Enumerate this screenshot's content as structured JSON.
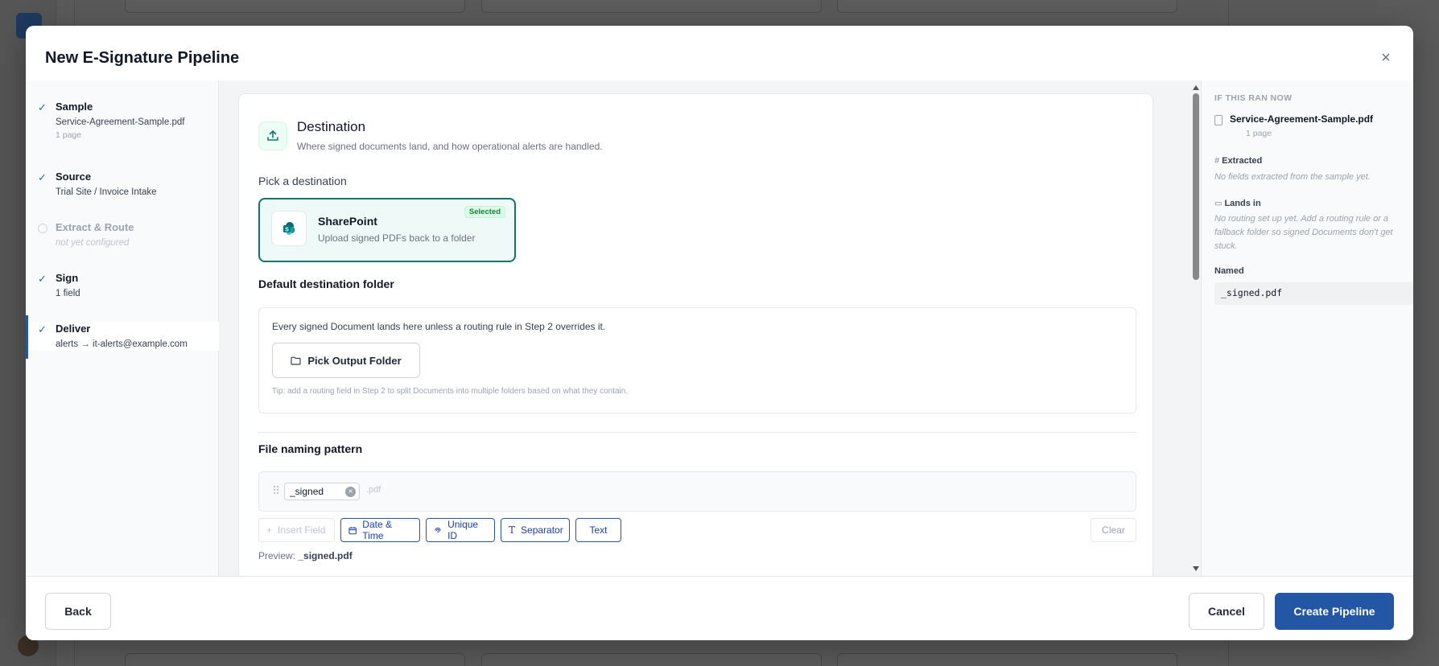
{
  "modal": {
    "title": "New E-Signature Pipeline",
    "close_icon": "×"
  },
  "steps": [
    {
      "title": "Sample",
      "sub": "Service-Agreement-Sample.pdf",
      "meta": "1 page",
      "status": "done"
    },
    {
      "title": "Source",
      "sub": "Trial Site / Invoice Intake",
      "status": "done"
    },
    {
      "title": "Extract & Route",
      "sub": "not yet configured",
      "status": "todo"
    },
    {
      "title": "Sign",
      "sub": "1 field",
      "status": "done"
    },
    {
      "title": "Deliver",
      "sub": "alerts → it-alerts@example.com",
      "status": "active"
    }
  ],
  "destination": {
    "title": "Destination",
    "subtitle": "Where signed documents land, and how operational alerts are handled.",
    "pick_label": "Pick a destination",
    "option": {
      "name": "SharePoint",
      "description": "Upload signed PDFs back to a folder",
      "badge": "Selected"
    }
  },
  "default_folder": {
    "label": "Default destination folder",
    "note": "Every signed Document lands here unless a routing rule in Step 2 overrides it.",
    "button": "Pick Output Folder",
    "tip": "Tip: add a routing field in Step 2 to split Documents into multiple folders based on what they contain."
  },
  "naming": {
    "label": "File naming pattern",
    "chip": "_signed",
    "extension": ".pdf",
    "buttons": {
      "insert_field": "Insert Field",
      "date_time": "Date & Time",
      "unique_id": "Unique ID",
      "separator": "Separator",
      "text": "Text",
      "clear": "Clear"
    },
    "preview_label": "Preview:",
    "preview_value": "_signed.pdf"
  },
  "preview_panel": {
    "kicker": "IF THIS RAN NOW",
    "file": "Service-Agreement-Sample.pdf",
    "pages": "1 page",
    "extracted_label": "Extracted",
    "extracted_note": "No fields extracted from the sample yet.",
    "lands_label": "Lands in",
    "lands_note": "No routing set up yet. Add a routing rule or a fallback folder so signed Documents don't get stuck.",
    "named_label": "Named",
    "named_value": "_signed.pdf"
  },
  "footer": {
    "back": "Back",
    "cancel": "Cancel",
    "create": "Create Pipeline"
  },
  "colors": {
    "accent": "#2456a6",
    "selected_border": "#0f766e",
    "selected_badge": "#15803d"
  }
}
